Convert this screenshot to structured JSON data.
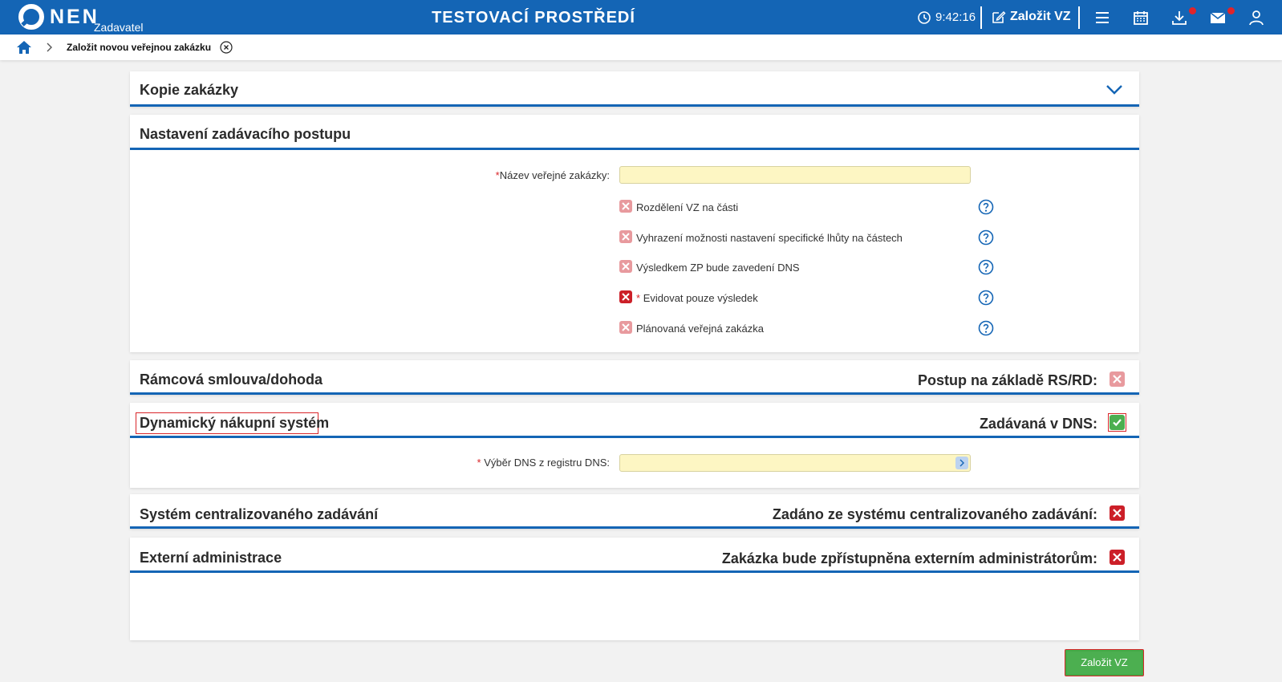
{
  "header": {
    "logo_text": "NEN",
    "logo_sub": "Zadavatel",
    "environment_title": "TESTOVACÍ PROSTŘEDÍ",
    "clock": "9:42:16",
    "create_link": "Založit VZ",
    "icons": [
      "clock-icon",
      "edit-icon",
      "menu-icon",
      "calendar-icon",
      "download-icon",
      "mail-icon",
      "user-icon"
    ]
  },
  "breadcrumb": {
    "current": "Založit novou veřejnou zakázku"
  },
  "sections": {
    "copy": {
      "title": "Kopie zakázky"
    },
    "procedure": {
      "title": "Nastavení zadávacího postupu",
      "name_label": "Název veřejné zakázky:",
      "name_value": "",
      "options": [
        {
          "label": "Rozdělení VZ na části",
          "checked": false,
          "required": false
        },
        {
          "label": "Vyhrazení možnosti nastavení specifické lhůty na částech",
          "checked": false,
          "required": false
        },
        {
          "label": "Výsledkem ZP bude zavedení DNS",
          "checked": false,
          "required": false
        },
        {
          "label": "Evidovat pouze výsledek",
          "checked": false,
          "required": true
        },
        {
          "label": "Plánovaná veřejná zakázka",
          "checked": false,
          "required": false
        }
      ]
    },
    "framework": {
      "title": "Rámcová smlouva/dohoda",
      "right_label": "Postup na základě RS/RD:",
      "checked": false
    },
    "dns": {
      "title": "Dynamický nákupní systém",
      "right_label": "Zadávaná v DNS:",
      "checked": true,
      "select_label": "Výběr DNS z registru DNS:",
      "select_value": ""
    },
    "central": {
      "title": "Systém centralizovaného zadávání",
      "right_label": "Zadáno ze systému centralizovaného zadávání:",
      "checked": false
    },
    "external": {
      "title": "Externí administrace",
      "right_label": "Zakázka bude zpřístupněna externím administrátorům:",
      "checked": false
    }
  },
  "actions": {
    "create_button": "Založit VZ"
  },
  "colors": {
    "brand_blue": "#1465b5",
    "input_yellow": "#fdf6c3",
    "check_green": "#4caf50",
    "cross_red": "#cc1f28",
    "cross_light": "#e89a9e"
  }
}
